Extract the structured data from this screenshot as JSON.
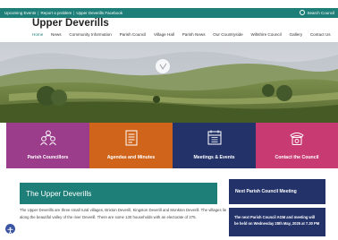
{
  "topbar": {
    "links": [
      "Upcoming Events",
      "Report a problem",
      "Upper Deverills Facebook"
    ],
    "search_label": "Search Council"
  },
  "site": {
    "title": "Upper Deverills"
  },
  "nav": {
    "items": [
      "Home",
      "News",
      "Community Information",
      "Parish Council",
      "Village Hall",
      "Parish News",
      "Our Countryside",
      "Wiltshire Council",
      "Gallery",
      "Contact Us"
    ]
  },
  "tiles": [
    {
      "label": "Parish Councillors",
      "color": "#9b3d8b",
      "icon": "people-icon"
    },
    {
      "label": "Agendas and Minutes",
      "color": "#d0641a",
      "icon": "document-icon"
    },
    {
      "label": "Meetings & Events",
      "color": "#23336a",
      "icon": "calendar-icon"
    },
    {
      "label": "Contact the Council",
      "color": "#c83a72",
      "icon": "telephone-icon"
    }
  ],
  "main": {
    "heading": "The Upper Deverills",
    "text": "The Upper Deverills are three small rural villages, Brixton Deverill, Kingston Deverill and Monkton Deverill. The villages lie along the beautiful valley of the river Deverill. There are some 130 households with an electorate of 275."
  },
  "sidebar": {
    "heading": "Next Parish Council Meeting",
    "news": "The next Parish Council AGM and meeting will be held on Wednesday 28th May, 2025 at 7.30 PM"
  },
  "colors": {
    "accent": "#1e7f78",
    "navy": "#23336a"
  }
}
